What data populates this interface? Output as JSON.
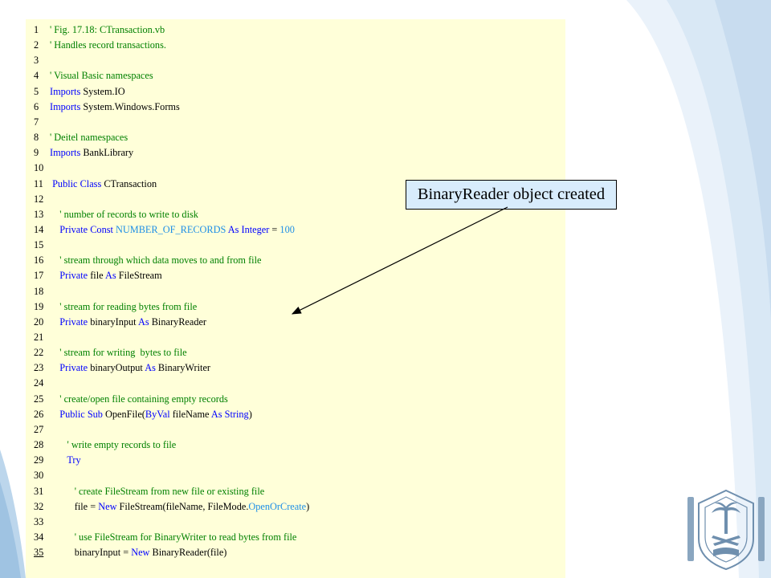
{
  "callout": {
    "text": "BinaryReader object created"
  },
  "code": {
    "lines": [
      {
        "n": "1",
        "indent": "",
        "segs": [
          {
            "t": "' Fig. 17.18: CTransaction.vb",
            "c": "cm"
          }
        ]
      },
      {
        "n": "2",
        "indent": "",
        "segs": [
          {
            "t": "' Handles record transactions.",
            "c": "cm"
          }
        ]
      },
      {
        "n": "3",
        "indent": "",
        "segs": []
      },
      {
        "n": "4",
        "indent": "",
        "segs": [
          {
            "t": "' Visual Basic namespaces",
            "c": "cm"
          }
        ]
      },
      {
        "n": "5",
        "indent": "",
        "segs": [
          {
            "t": "Imports",
            "c": "kw"
          },
          {
            "t": " System.IO",
            "c": ""
          }
        ]
      },
      {
        "n": "6",
        "indent": "",
        "segs": [
          {
            "t": "Imports",
            "c": "kw"
          },
          {
            "t": " System.Windows.Forms",
            "c": ""
          }
        ]
      },
      {
        "n": "7",
        "indent": "",
        "segs": []
      },
      {
        "n": "8",
        "indent": "",
        "segs": [
          {
            "t": "' Deitel namespaces",
            "c": "cm"
          }
        ]
      },
      {
        "n": "9",
        "indent": "",
        "segs": [
          {
            "t": "Imports",
            "c": "kw"
          },
          {
            "t": " BankLibrary",
            "c": ""
          }
        ]
      },
      {
        "n": "10",
        "indent": "",
        "segs": []
      },
      {
        "n": "11",
        "indent": " ",
        "segs": [
          {
            "t": "Public",
            "c": "kw"
          },
          {
            "t": " ",
            "c": ""
          },
          {
            "t": "Class",
            "c": "kw"
          },
          {
            "t": " CTransaction",
            "c": ""
          }
        ]
      },
      {
        "n": "12",
        "indent": "",
        "segs": []
      },
      {
        "n": "13",
        "indent": "    ",
        "segs": [
          {
            "t": "' number of records to write to disk",
            "c": "cm"
          }
        ]
      },
      {
        "n": "14",
        "indent": "    ",
        "segs": [
          {
            "t": "Private",
            "c": "kw"
          },
          {
            "t": " ",
            "c": ""
          },
          {
            "t": "Const",
            "c": "kw"
          },
          {
            "t": " NUMBER_OF_RECORDS ",
            "c": "lit"
          },
          {
            "t": "As",
            "c": "kw"
          },
          {
            "t": " ",
            "c": ""
          },
          {
            "t": "Integer",
            "c": "kw"
          },
          {
            "t": " = ",
            "c": ""
          },
          {
            "t": "100",
            "c": "lit"
          }
        ]
      },
      {
        "n": "15",
        "indent": "",
        "segs": []
      },
      {
        "n": "16",
        "indent": "    ",
        "segs": [
          {
            "t": "' stream through which data moves to and from file",
            "c": "cm"
          }
        ]
      },
      {
        "n": "17",
        "indent": "    ",
        "segs": [
          {
            "t": "Private",
            "c": "kw"
          },
          {
            "t": " file ",
            "c": ""
          },
          {
            "t": "As",
            "c": "kw"
          },
          {
            "t": " FileStream",
            "c": ""
          }
        ]
      },
      {
        "n": "18",
        "indent": "",
        "segs": []
      },
      {
        "n": "19",
        "indent": "    ",
        "segs": [
          {
            "t": "' stream for reading bytes from file",
            "c": "cm"
          }
        ]
      },
      {
        "n": "20",
        "indent": "    ",
        "segs": [
          {
            "t": "Private",
            "c": "kw"
          },
          {
            "t": " binaryInput ",
            "c": ""
          },
          {
            "t": "As",
            "c": "kw"
          },
          {
            "t": " BinaryReader",
            "c": ""
          }
        ]
      },
      {
        "n": "21",
        "indent": "",
        "segs": []
      },
      {
        "n": "22",
        "indent": "    ",
        "segs": [
          {
            "t": "' stream for writing  bytes to file",
            "c": "cm"
          }
        ]
      },
      {
        "n": "23",
        "indent": "    ",
        "segs": [
          {
            "t": "Private",
            "c": "kw"
          },
          {
            "t": " binaryOutput ",
            "c": ""
          },
          {
            "t": "As",
            "c": "kw"
          },
          {
            "t": " BinaryWriter",
            "c": ""
          }
        ]
      },
      {
        "n": "24",
        "indent": "",
        "segs": []
      },
      {
        "n": "25",
        "indent": "    ",
        "segs": [
          {
            "t": "' create/open file containing empty records",
            "c": "cm"
          }
        ]
      },
      {
        "n": "26",
        "indent": "    ",
        "segs": [
          {
            "t": "Public",
            "c": "kw"
          },
          {
            "t": " ",
            "c": ""
          },
          {
            "t": "Sub",
            "c": "kw"
          },
          {
            "t": " OpenFile(",
            "c": ""
          },
          {
            "t": "ByVal",
            "c": "kw"
          },
          {
            "t": " fileName ",
            "c": ""
          },
          {
            "t": "As",
            "c": "kw"
          },
          {
            "t": " ",
            "c": ""
          },
          {
            "t": "String",
            "c": "kw"
          },
          {
            "t": ")",
            "c": ""
          }
        ]
      },
      {
        "n": "27",
        "indent": "",
        "segs": []
      },
      {
        "n": "28",
        "indent": "       ",
        "segs": [
          {
            "t": "' write empty records to file",
            "c": "cm"
          }
        ]
      },
      {
        "n": "29",
        "indent": "       ",
        "segs": [
          {
            "t": "Try",
            "c": "kw"
          }
        ]
      },
      {
        "n": "30",
        "indent": "",
        "segs": []
      },
      {
        "n": "31",
        "indent": "          ",
        "segs": [
          {
            "t": "' create FileStream from new file or existing file",
            "c": "cm"
          }
        ]
      },
      {
        "n": "32",
        "indent": "          ",
        "segs": [
          {
            "t": "file = ",
            "c": ""
          },
          {
            "t": "New",
            "c": "kw"
          },
          {
            "t": " FileStream(fileName, FileMode.",
            "c": ""
          },
          {
            "t": "OpenOrCreate",
            "c": "lit"
          },
          {
            "t": ")",
            "c": ""
          }
        ]
      },
      {
        "n": "33",
        "indent": "",
        "segs": []
      },
      {
        "n": "34",
        "indent": "          ",
        "segs": [
          {
            "t": "' use FileStream for BinaryWriter to read bytes from file",
            "c": "cm"
          }
        ]
      },
      {
        "n": "35",
        "indent": "          ",
        "segs": [
          {
            "t": "binaryInput = ",
            "c": ""
          },
          {
            "t": "New",
            "c": "kw"
          },
          {
            "t": " BinaryReader(file)",
            "c": ""
          }
        ],
        "underline_num": true
      }
    ]
  }
}
